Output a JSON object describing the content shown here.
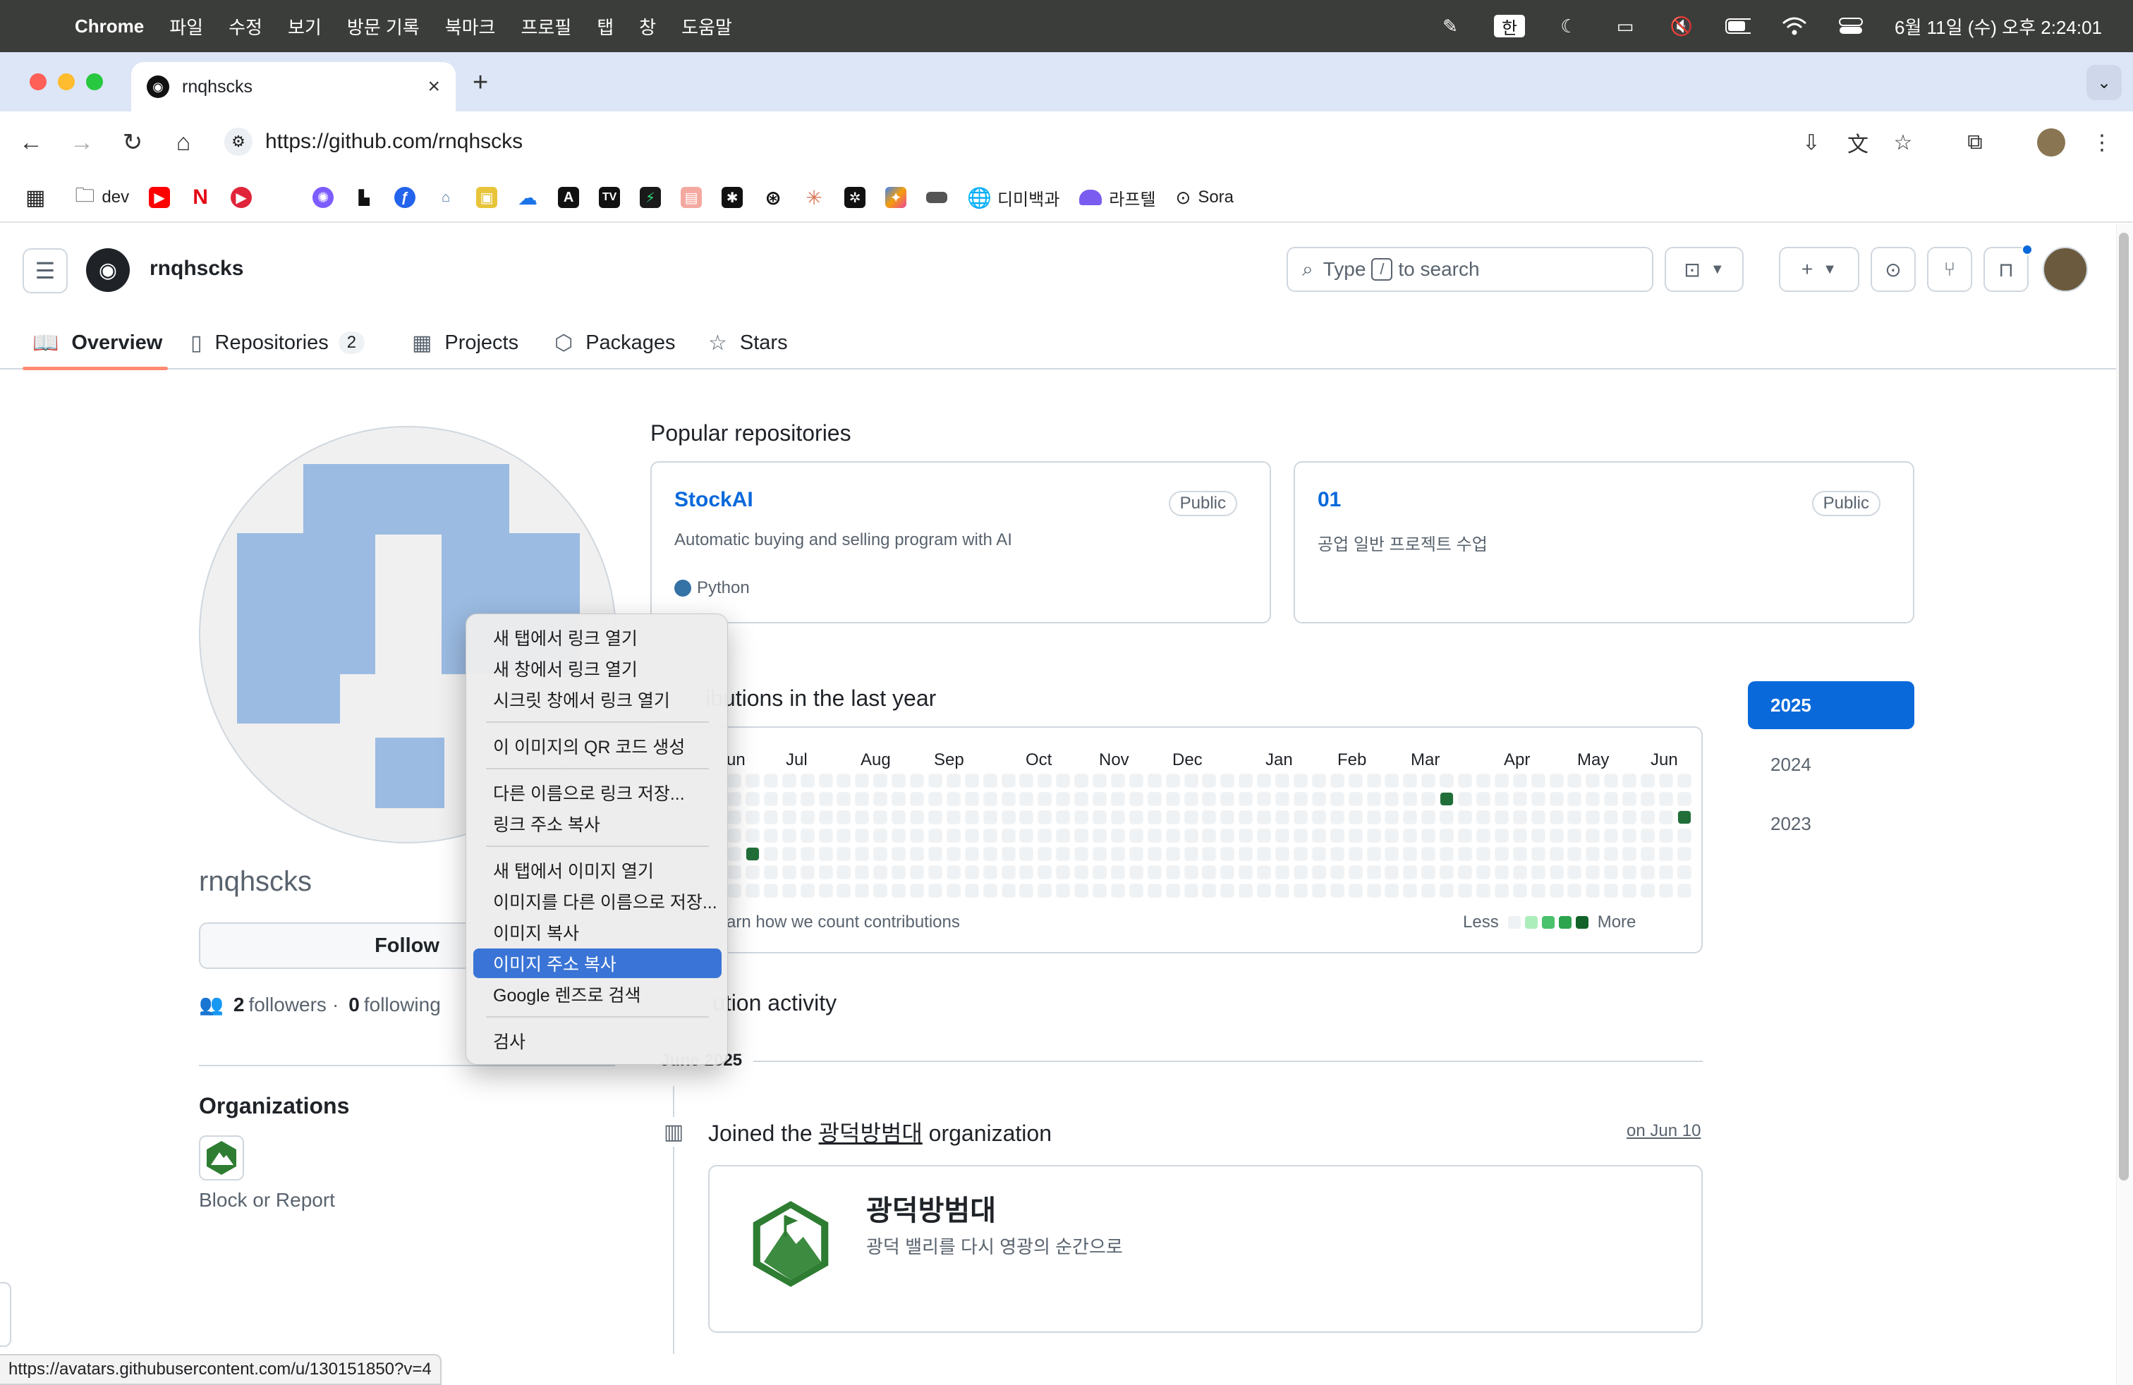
{
  "menubar": {
    "app": "Chrome",
    "items": [
      "파일",
      "수정",
      "보기",
      "방문 기록",
      "북마크",
      "프로필",
      "탭",
      "창",
      "도움말"
    ],
    "input_method": "한",
    "clock": "6월 11일 (수) 오후 2:24:01"
  },
  "browser": {
    "tab_title": "rnqhscks",
    "url": "https://github.com/rnqhscks",
    "bookmarks": [
      "dev",
      "디미백과",
      "라프텔",
      "Sora"
    ]
  },
  "github": {
    "header_username": "rnqhscks",
    "search_prefix": "Type",
    "search_slash": "/",
    "search_suffix": "to search",
    "nav": {
      "overview": "Overview",
      "repositories": "Repositories",
      "repositories_count": "2",
      "projects": "Projects",
      "packages": "Packages",
      "stars": "Stars"
    }
  },
  "profile": {
    "username": "rnqhscks",
    "follow_label": "Follow",
    "followers_count": "2",
    "followers_label": "followers",
    "separator": "·",
    "following_count": "0",
    "following_label": "following",
    "organizations_title": "Organizations",
    "block_report": "Block or Report"
  },
  "popular": {
    "title": "Popular repositories",
    "repos": [
      {
        "name": "StockAI",
        "visibility": "Public",
        "description": "Automatic buying and selling program with AI",
        "language": "Python",
        "language_color": "#3572A5"
      },
      {
        "name": "01",
        "visibility": "Public",
        "description": "공업 일반 프로젝트 수업"
      }
    ]
  },
  "contributions": {
    "title_visible": "ibutions in the last year",
    "months": [
      "un",
      "Jul",
      "Aug",
      "Sep",
      "Oct",
      "Nov",
      "Dec",
      "Jan",
      "Feb",
      "Mar",
      "Apr",
      "May",
      "Jun"
    ],
    "learn_visible": "arn how we count contributions",
    "legend_less": "Less",
    "legend_more": "More",
    "legend_colors": [
      "#eff2f5",
      "#aceebb",
      "#4ac26b",
      "#2da44e",
      "#116329"
    ],
    "highlight_cells": [
      {
        "week": 1,
        "day": 4,
        "color": "#216e39"
      },
      {
        "week": 39,
        "day": 1,
        "color": "#216e39"
      },
      {
        "week": 52,
        "day": 2,
        "color": "#216e39"
      }
    ]
  },
  "years": [
    "2025",
    "2024",
    "2023"
  ],
  "activity": {
    "title_visible": "ution activity",
    "month_visible": "June 2025",
    "joined_prefix": "Joined the",
    "org_name": "광덕방범대",
    "joined_suffix": "organization",
    "date": "on Jun 10",
    "org_desc": "광덕 밸리를 다시 영광의 순간으로"
  },
  "status_url": "https://avatars.githubusercontent.com/u/130151850?v=4",
  "context_menu": {
    "group1": [
      "새 탭에서 링크 열기",
      "새 창에서 링크 열기",
      "시크릿 창에서 링크 열기"
    ],
    "group2": [
      "이 이미지의 QR 코드 생성"
    ],
    "group3": [
      "다른 이름으로 링크 저장...",
      "링크 주소 복사"
    ],
    "group4": [
      "새 탭에서 이미지 열기",
      "이미지를 다른 이름으로 저장...",
      "이미지 복사",
      "이미지 주소 복사",
      "Google 렌즈로 검색"
    ],
    "group5": [
      "검사"
    ],
    "highlighted": "이미지 주소 복사"
  },
  "colors": {
    "accent": "#0969da",
    "tab_underline": "#fd8c73",
    "avatar_blue": "#9bbbe2",
    "menu_highlight": "#3a74d6"
  }
}
